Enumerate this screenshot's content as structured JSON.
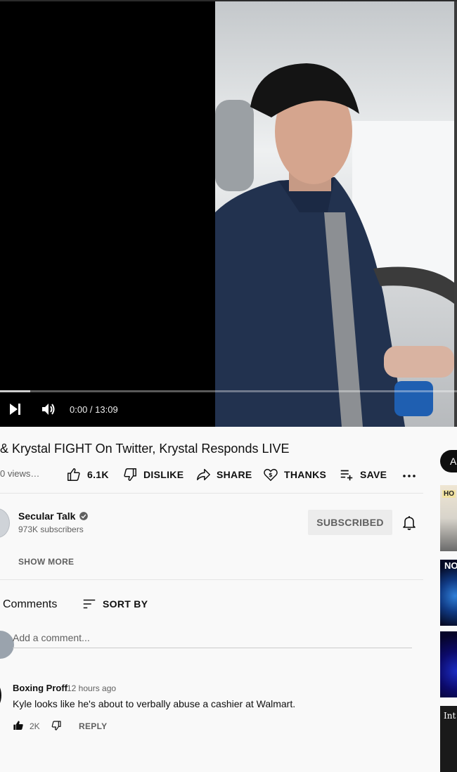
{
  "player": {
    "time_display": "0:00 / 13:09",
    "progress_fraction": 0.0,
    "buffered_fraction": 0.066
  },
  "video": {
    "title": "& Krystal FIGHT On Twitter, Krystal Responds LIVE",
    "views": "0 views…"
  },
  "actions": {
    "like_count": "6.1K",
    "dislike_label": "DISLIKE",
    "share_label": "SHARE",
    "thanks_label": "THANKS",
    "save_label": "SAVE"
  },
  "channel": {
    "name": "Secular Talk",
    "subscribers": "973K subscribers",
    "subscribe_state": "SUBSCRIBED",
    "show_more": "SHOW MORE"
  },
  "comments": {
    "header": "Comments",
    "sort_label": "SORT BY",
    "add_placeholder": "Add a comment...",
    "items": [
      {
        "author": "Boxing Proff",
        "time": "12 hours ago",
        "text": "Kyle looks like he's about to verbally abuse a cashier at Walmart.",
        "likes": "2K",
        "reply_label": "REPLY"
      }
    ]
  },
  "sidebar": {
    "chip_label": "Al",
    "thumbs": [
      {
        "label": "HO"
      },
      {
        "label": "NO"
      },
      {
        "label": ""
      },
      {
        "label": "Int"
      }
    ]
  },
  "colors": {
    "text_primary": "#0f0f0f",
    "text_secondary": "#606060",
    "page_bg": "#f9f9f9"
  }
}
